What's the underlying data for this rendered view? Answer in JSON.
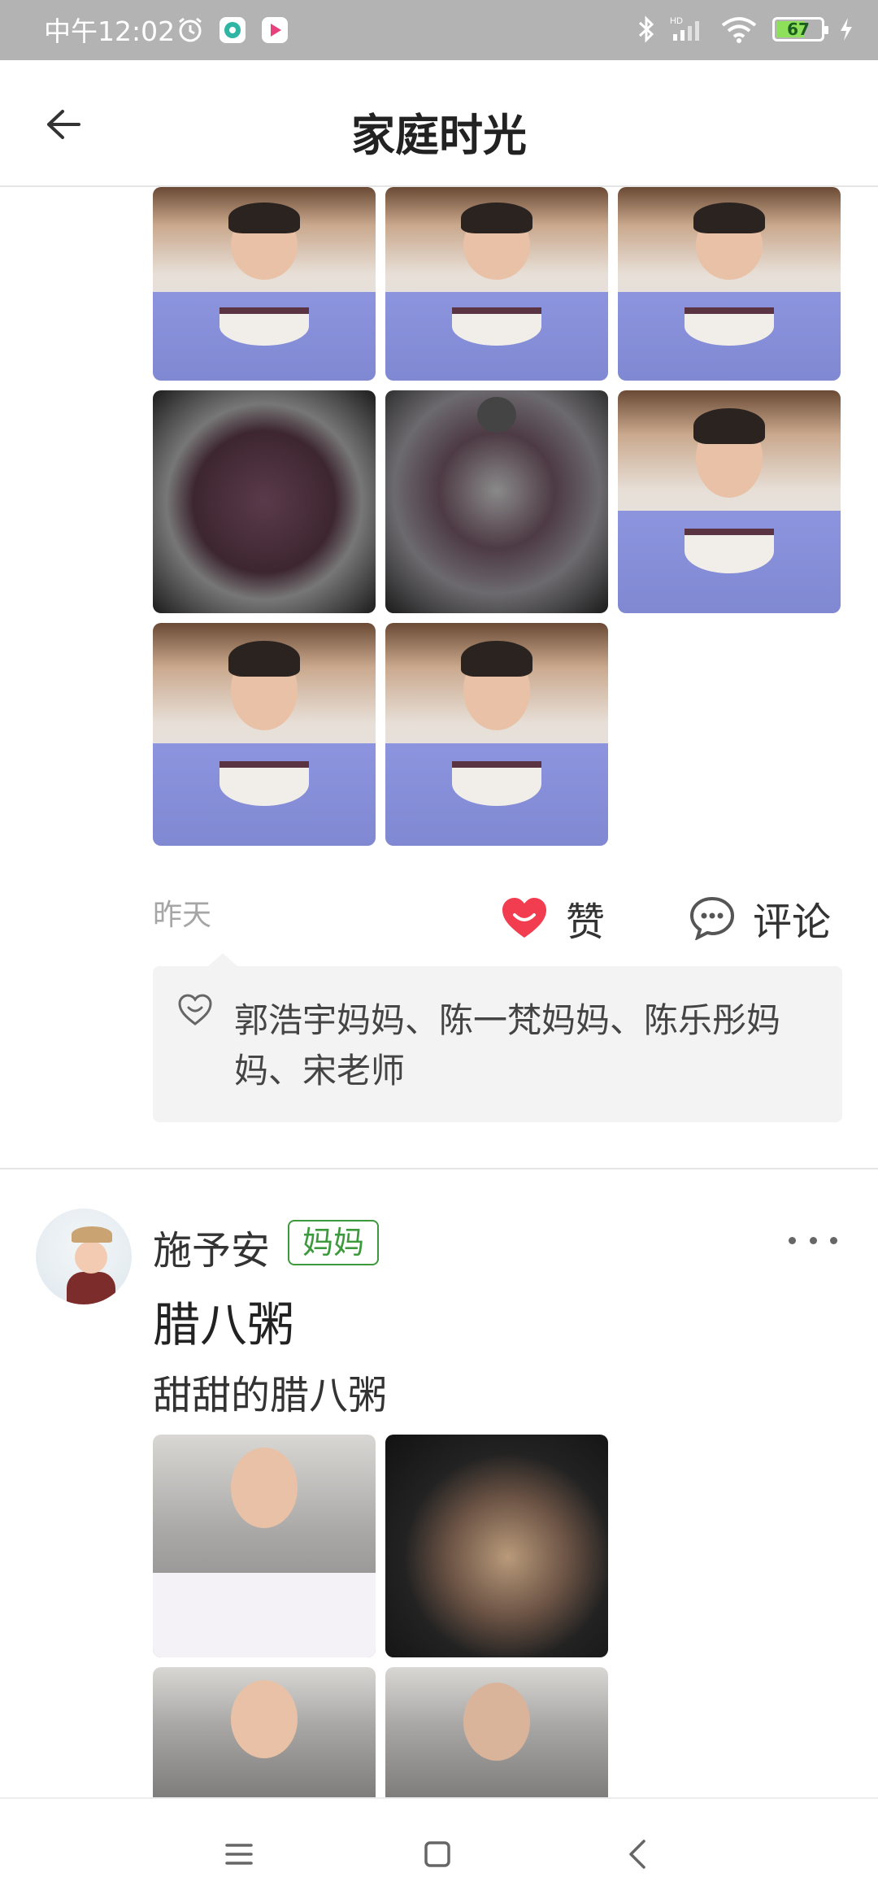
{
  "status_bar": {
    "time": "中午12:02",
    "battery": "67",
    "battery_level": 0.67
  },
  "header": {
    "title": "家庭时光"
  },
  "post1": {
    "time": "昨天",
    "like_label": "赞",
    "comment_label": "评论",
    "likers": "郭浩宇妈妈、陈一梵妈妈、陈乐彤妈妈、宋老师"
  },
  "post2": {
    "author": "施予安",
    "role": "妈妈",
    "title": "腊八粥",
    "body": "甜甜的腊八粥"
  },
  "colors": {
    "accent_green": "#3c9a3c",
    "like_red": "#f23c4f",
    "status_bar_bg": "#b3b3b3"
  },
  "icons": [
    "back-arrow-icon",
    "heart-icon",
    "comment-icon",
    "more-icon",
    "menu-icon",
    "home-icon",
    "nav-back-icon"
  ]
}
